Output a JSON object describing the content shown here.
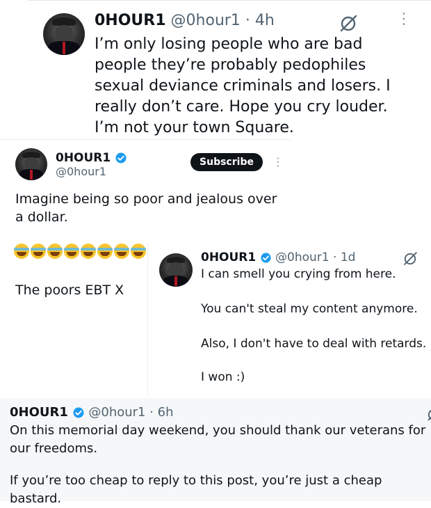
{
  "colors": {
    "verified": "#1d9bf0",
    "subscribe_bg": "#0f1419",
    "text": "#0f1419",
    "muted": "#536471"
  },
  "tweet1": {
    "name": "0HOUR1",
    "handle_time": "@0hour1 · 4h",
    "text": "I’m only losing people who are bad people they’re probably pedophiles sexual deviance criminals and losers. I really don’t care. Hope you cry louder. I’m not your town Square.",
    "grok_icon": "grok-icon",
    "more_icon": "more-vertical-icon"
  },
  "tweet2": {
    "name": "0HOUR1",
    "handle": "@0hour1",
    "subscribe_label": "Subscribe",
    "more_icon": "more-vertical-icon",
    "text": "Imagine being so poor and jealous over a dollar."
  },
  "reply": {
    "emoji": "😂😂😂😂😂😂😂😂",
    "text": "The poors EBT X"
  },
  "tweet3": {
    "name": "0HOUR1",
    "handle_time": "@0hour1 · 1d",
    "lines": [
      "I can smell you crying from here.",
      "You can't steal my content anymore.",
      "Also, I don't have to deal with retards.",
      "I won  :)"
    ]
  },
  "tweet4": {
    "name": "0HOUR1",
    "handle_time": "@0hour1 · 6h",
    "lines": [
      "On this memorial day weekend, you should thank our veterans for our freedoms.",
      "If you’re too cheap to reply to this post, you’re just a cheap bastard."
    ]
  }
}
